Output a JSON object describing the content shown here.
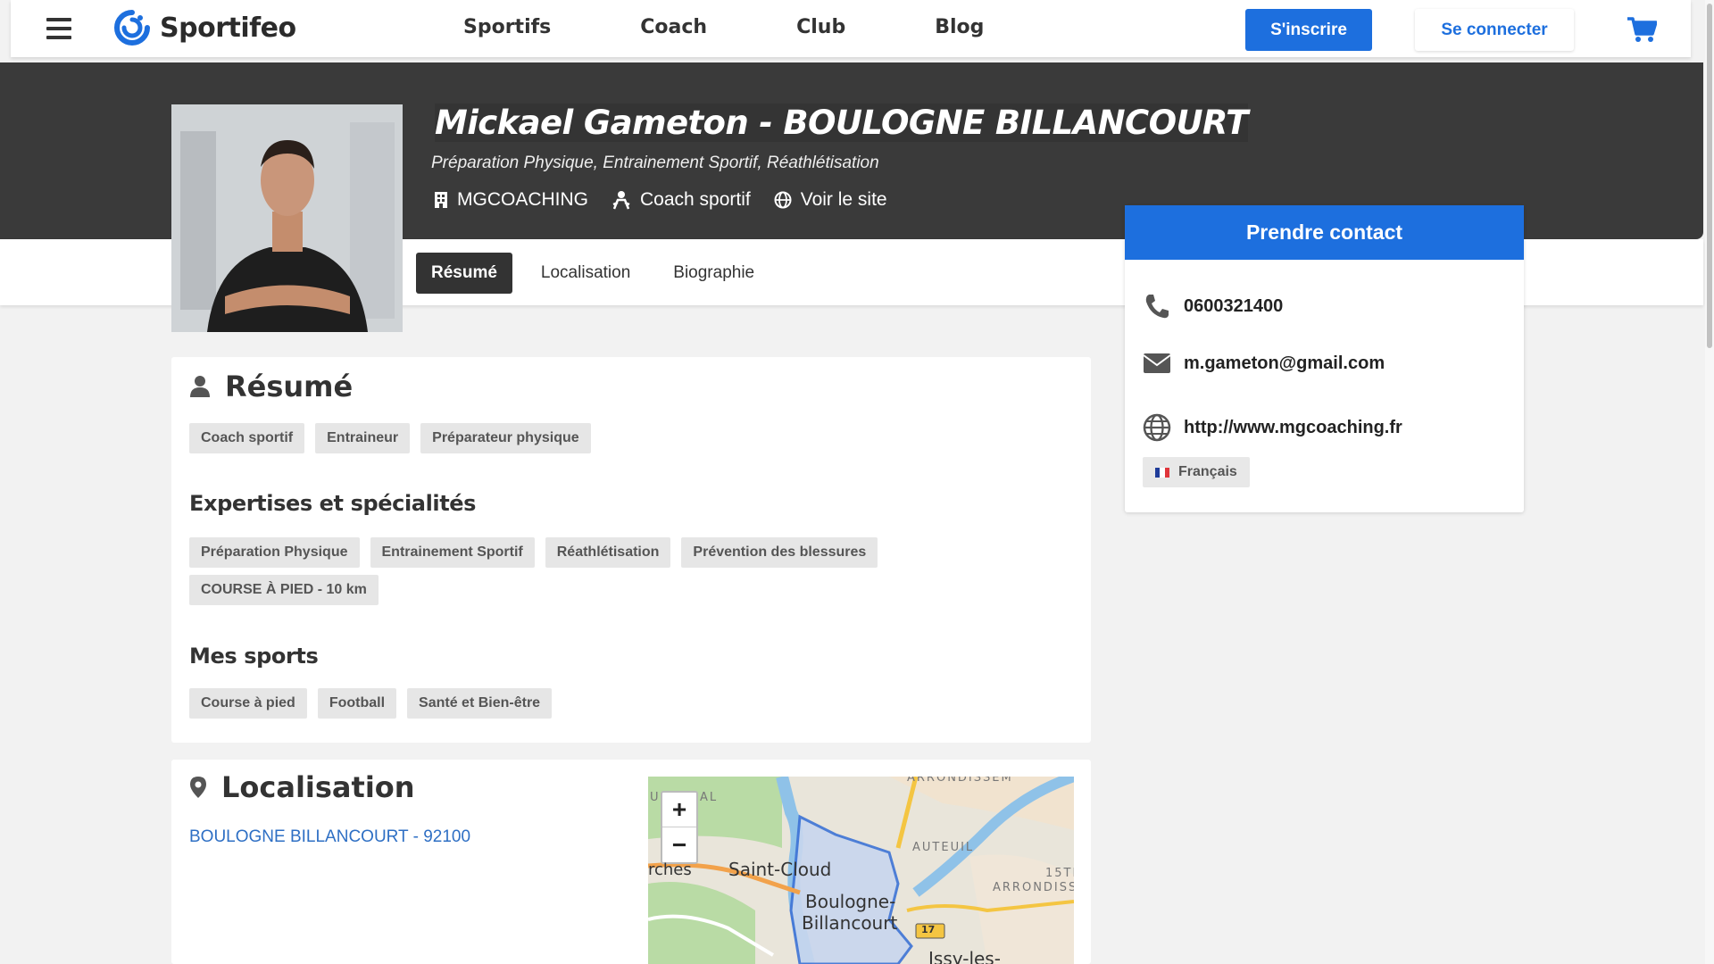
{
  "nav": {
    "brand": "Sportifeo",
    "links": [
      "Sportifs",
      "Coach",
      "Club",
      "Blog"
    ],
    "signup_label": "S'inscrire",
    "login_label": "Se connecter",
    "colors": {
      "primary": "#1d6fde",
      "hero_bg": "#3a3a3a"
    }
  },
  "profile": {
    "title": "Mickael Gameton - BOULOGNE BILLANCOURT",
    "subtitle": "Préparation Physique, Entrainement Sportif, Réathlétisation",
    "company": "MGCOACHING",
    "role": "Coach sportif",
    "website_link": "Voir le site"
  },
  "tabs": [
    "Résumé",
    "Localisation",
    "Biographie"
  ],
  "contact": {
    "header": "Prendre contact",
    "phone": "0600321400",
    "email": "m.gameton@gmail.com",
    "website": "http://www.mgcoaching.fr",
    "language": "Français"
  },
  "resume": {
    "title": "Résumé",
    "roles": [
      "Coach sportif",
      "Entraineur",
      "Préparateur physique"
    ],
    "expertise_title": "Expertises et spécialités",
    "expertise": [
      "Préparation Physique",
      "Entrainement Sportif",
      "Réathlétisation",
      "Prévention des blessures",
      "COURSE À PIED - 10 km"
    ],
    "sports_title": "Mes sports",
    "sports": [
      "Course à pied",
      "Football",
      "Santé et Bien-être"
    ]
  },
  "location": {
    "title": "Localisation",
    "address": "BOULOGNE BILLANCOURT - 92100",
    "map": {
      "zoom_in": "+",
      "zoom_out": "−",
      "labels": [
        "Saint-Cloud",
        "Boulogne-",
        "Billancourt",
        "Issy-les-",
        "rches",
        "AUTEUIL",
        "15TI",
        "ARRONDISS",
        "ARRONDISSEM",
        "AL",
        "U",
        "17"
      ]
    }
  }
}
